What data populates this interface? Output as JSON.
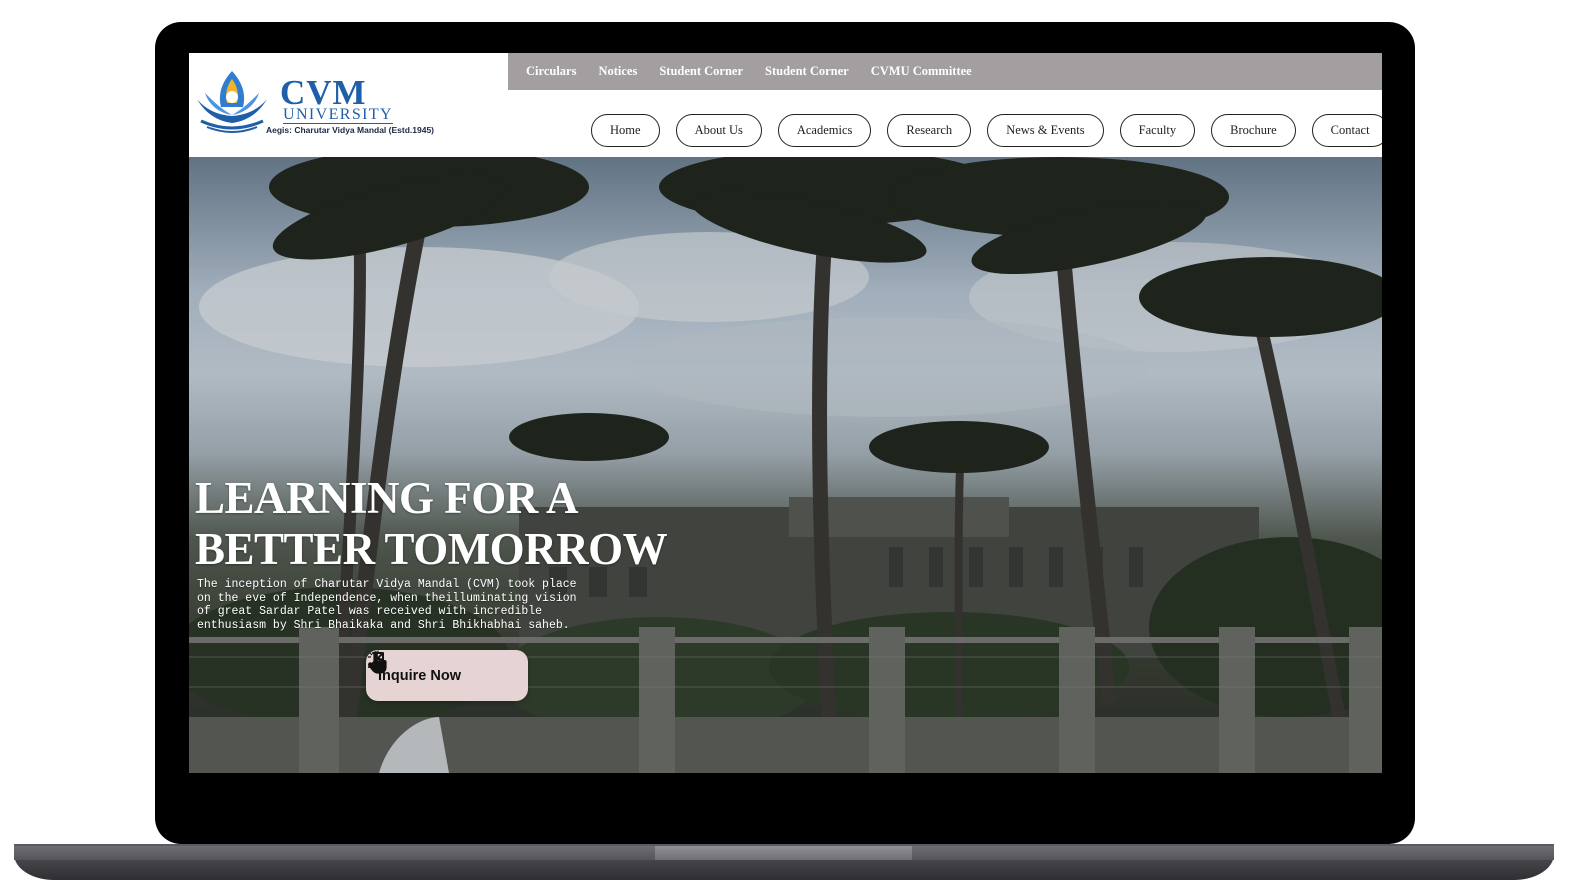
{
  "topbar": {
    "links": [
      "Circulars",
      "Notices",
      "Student Corner",
      "Student Corner",
      "CVMU Committee"
    ]
  },
  "logo": {
    "name": "CVM",
    "subname": "UNIVERSITY",
    "aegis": "Aegis: Charutar Vidya Mandal (Estd.1945)"
  },
  "nav": {
    "items": [
      "Home",
      "About Us",
      "Academics",
      "Research",
      "News & Events",
      "Faculty",
      "Brochure",
      "Contact"
    ]
  },
  "hero": {
    "headline_line1": "LEARNING FOR A",
    "headline_line2": "BETTER TOMORROW",
    "description": "The inception of Charutar Vidya Mandal (CVM) took place on the eve of Independence, when theilluminating vision of great Sardar Patel was received with incredible enthusiasm by Shri Bhaikaka and Shri Bhikhabhai saheb.",
    "cta_label": "Inquire Now",
    "cta_icons": [
      "hand-pointer-icon",
      "arrow-up-right-icon"
    ]
  },
  "colors": {
    "topbar_bg": "#a39e9f",
    "brand_blue": "#1f5ea8",
    "cta_bg": "#e6d3d3"
  }
}
